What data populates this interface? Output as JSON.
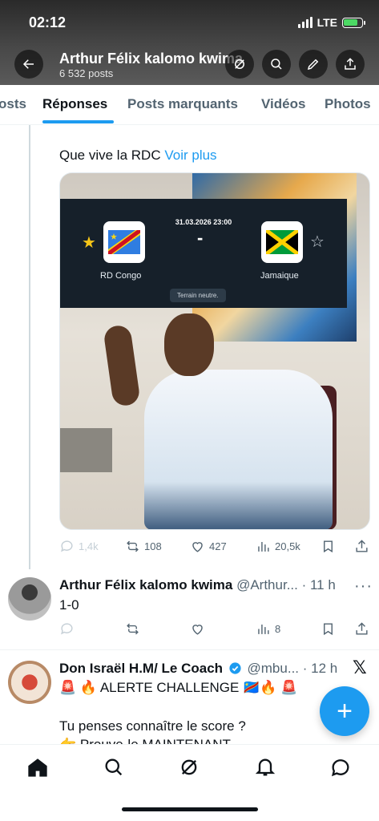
{
  "status": {
    "time": "02:12",
    "network": "LTE"
  },
  "header": {
    "title": "Arthur Félix kalomo kwima",
    "subtitle": "6 532 posts"
  },
  "tabs": [
    {
      "label": "osts"
    },
    {
      "label": "Réponses",
      "active": true
    },
    {
      "label": "Posts marquants"
    },
    {
      "label": "Vidéos"
    },
    {
      "label": "Photos"
    }
  ],
  "post1": {
    "text": "Que vive la RDC",
    "more_link": "Voir plus",
    "scorecard": {
      "datetime": "31.03.2026 23:00",
      "separator": "-",
      "home_team": "RD Congo",
      "away_team": "Jamaique",
      "venue_note": "Terrain neutre."
    },
    "stats": {
      "replies": "1,4k",
      "reposts": "108",
      "likes": "427",
      "views": "20,5k"
    }
  },
  "post2": {
    "name": "Arthur Félix kalomo kwima",
    "handle": "@Arthur...",
    "time": "· 11 h",
    "text": "1-0",
    "stats": {
      "views": "8"
    }
  },
  "post3": {
    "name": "Don Israël H.M/ Le Coach",
    "handle": "@mbu...",
    "time": "· 12 h",
    "line1": "🚨 🔥 ALERTE CHALLENGE 🇨🇩🔥 🚨",
    "line2": "Tu penses connaître le score ?",
    "line3": "👉 Prouve-le MAINTENANT"
  },
  "colors": {
    "accent": "#1d9bf0",
    "text": "#0f1419",
    "muted": "#536471"
  }
}
